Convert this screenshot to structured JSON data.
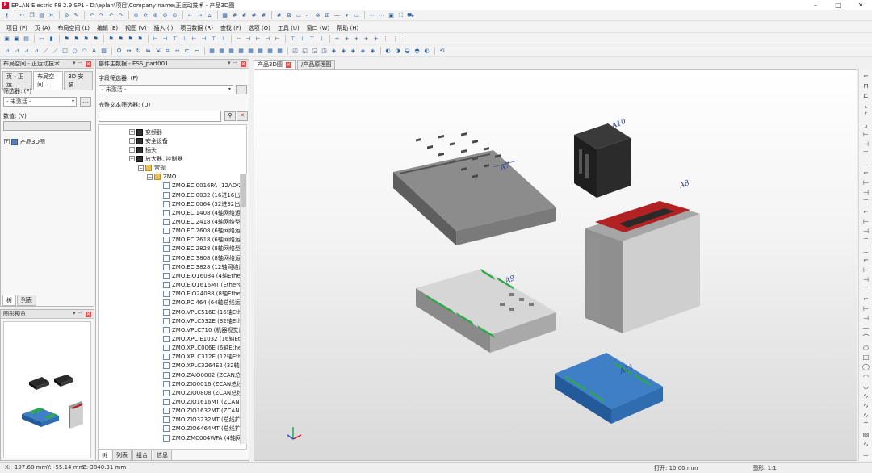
{
  "window": {
    "title": "EPLAN Electric P8 2.9 SP1 - D:\\eplan\\项目\\Company name\\正运动技术 - 产品3D图",
    "logo": "E",
    "controls": {
      "minimize": "–",
      "maximize": "□",
      "close": "✕"
    }
  },
  "menu": [
    "项目 (P)",
    "页 (A)",
    "布局空间 (L)",
    "编辑 (E)",
    "视图 (V)",
    "插入 (I)",
    "项目数据 (R)",
    "查找 (F)",
    "选项 (O)",
    "工具 (U)",
    "窗口 (W)",
    "帮助 (H)"
  ],
  "layout_panel": {
    "title": "布局空间 - 正运动技术",
    "tabs": [
      "页 - 正运...",
      "布局空间...",
      "3D 安装..."
    ],
    "filter_label": "筛选器: (F)",
    "filter_value": "- 未激活 -",
    "filter_btn": "...",
    "value_label": "数值: (V)",
    "tree_root": "产品3D图",
    "bottom_tabs": [
      "树",
      "列表"
    ]
  },
  "preview_panel": {
    "title": "图形预览"
  },
  "parts_panel": {
    "title": "部件主数据 - ESS_part001",
    "field_filter_label": "字段筛选器: (F)",
    "field_filter_value": "- 未激活 -",
    "field_filter_btn": "...",
    "fulltext_label": "完整文本筛选器: (U)",
    "fulltext_value": "",
    "tree": [
      {
        "label": "变频器",
        "level": 0,
        "exp": "+",
        "icon": "dev"
      },
      {
        "label": "安全设备",
        "level": 0,
        "exp": "+",
        "icon": "dev"
      },
      {
        "label": "插头",
        "level": 0,
        "exp": "+",
        "icon": "dev"
      },
      {
        "label": "放大器, 控制器",
        "level": 0,
        "exp": "−",
        "icon": "dev"
      },
      {
        "label": "常规",
        "level": 1,
        "exp": "−",
        "icon": "folder"
      },
      {
        "label": "ZMO",
        "level": 2,
        "exp": "−",
        "icon": "folder"
      }
    ],
    "parts": [
      "ZMO.ECI0016PA (12AD/2D",
      "ZMO.ECI0032 (16进16出网",
      "ZMO.ECI0064 (32进32出网",
      "ZMO.ECI1408 (4轴网络运",
      "ZMO.ECI2418 (4轴网络型",
      "ZMO.ECI2608 (6轴网络运",
      "ZMO.ECI2618 (6轴网络运",
      "ZMO.ECI2828 (8轴网络型",
      "ZMO.ECI3808 (8轴网络运",
      "ZMO.ECI3828 (12轴网络运",
      "ZMO.EIO16084 (4轴EtherC",
      "ZMO.EIO1616MT (EtherC",
      "ZMO.EIO24088 (8轴EtherC",
      "ZMO.PCI464 (64轴总线运",
      "ZMO.VPLC516E (16轴Ethe",
      "ZMO.VPLC532E (32轴Ethe",
      "ZMO.VPLC710 (机器视觉运",
      "ZMO.XPCIE1032 (16轴Ethe",
      "ZMO.XPLC006E (6轴EtherC",
      "ZMO.XPLC312E (12轴EtherC",
      "ZMO.XPLC3264E2 (32轴Et",
      "ZMO.ZAIO0802 (ZCAN总线",
      "ZMO.ZIO0016 (ZCAN总线扩",
      "ZMO.ZIO0808 (ZCAN总线扩",
      "ZMO.ZIO1616MT (ZCAN总",
      "ZMO.ZIO1632MT (ZCAN总",
      "ZMO.ZIO3232MT (总线扩展",
      "ZMO.ZIO6464MT (总线扩展",
      "ZMO.ZMC004WFA (4轴网"
    ],
    "bottom_tabs": [
      "树",
      "列表",
      "组合",
      "信息"
    ]
  },
  "doc_tabs": [
    {
      "label": "产品3D图",
      "active": true
    },
    {
      "label": "/产品原理图",
      "active": false
    }
  ],
  "annotations": [
    "A7",
    "A10",
    "A8",
    "A9",
    "A11"
  ],
  "status": {
    "x": "X: -197.68 mm",
    "y": "Y: -55.14 mm",
    "z": "Z: 3840.31 mm",
    "snap": "打开: 10.00 mm",
    "scale": "图形: 1:1"
  },
  "colors": {
    "device_gray": "#8c8c8c",
    "device_light": "#cfcfcf",
    "device_dark": "#262626",
    "device_blue": "#3e7fc6",
    "terminal_green": "#2fa84a",
    "red_stripe": "#b22222",
    "annotation": "#2b3d9a"
  }
}
